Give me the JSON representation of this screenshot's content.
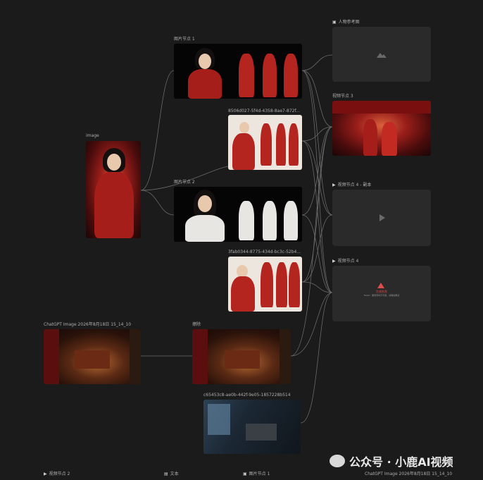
{
  "watermark": {
    "text": "公众号 · 小鹿AI视频"
  },
  "nodes": {
    "image_input": {
      "label": "image"
    },
    "image_node_1": {
      "label": "图片节点 1"
    },
    "file_1": {
      "label": "8506d027-5f4d-4358-8ae7-872f..."
    },
    "image_node_2": {
      "label": "图片节点 2"
    },
    "file_2": {
      "label": "3fab0344-8775-434d-bc3c-52b4..."
    },
    "chatgpt_image": {
      "label": "ChatGPT Image 2026年8月18日 15_14_10"
    },
    "delete_node": {
      "label": "擦除"
    },
    "file_3": {
      "label": "c65453c8-ae0b-442f-9e05-1857228b514"
    },
    "character_ref": {
      "label": "人物参考图"
    },
    "video_node_3": {
      "label": "视频节点 3"
    },
    "video_node_4_copy": {
      "label": "视频节点 4 - 副本"
    },
    "video_node_4": {
      "label": "视频节点 4",
      "status": "生成失败",
      "status_detail": "Failed · 服务暂时不可用，请稍后重试"
    }
  },
  "bottom_bar": {
    "items": [
      "视频节点 2",
      "文本",
      "图片节点 1",
      "ChatGPT Image 2026年8月18日 15_14_10"
    ]
  },
  "icons": {
    "image": "image-icon",
    "video": "play-icon",
    "text": "text-icon",
    "warning": "warning-icon",
    "wechat": "wechat-icon"
  },
  "colors": {
    "background": "#1b1b1b",
    "panel": "#2a2a2a",
    "wire": "#8a8a8a",
    "error": "#e04b4b"
  }
}
